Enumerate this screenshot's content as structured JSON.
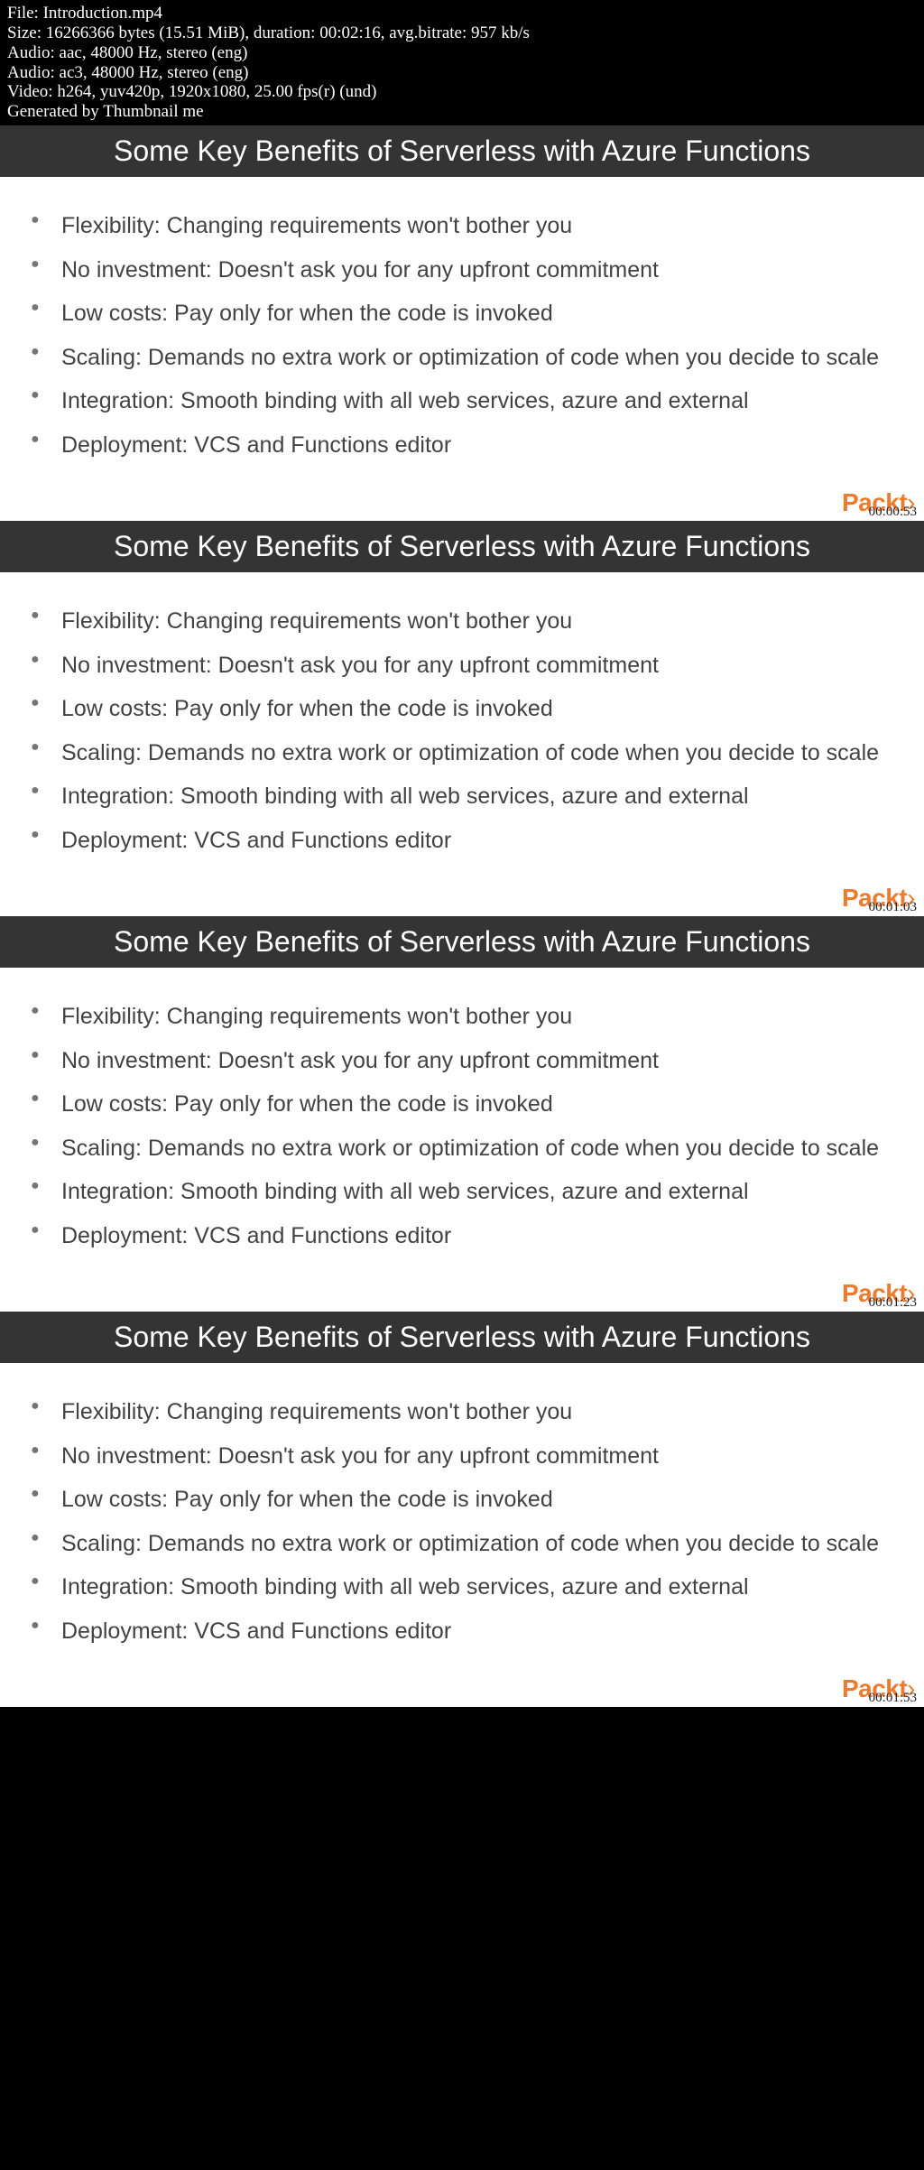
{
  "metadata": {
    "line1": "File: Introduction.mp4",
    "line2": "Size: 16266366 bytes (15.51 MiB), duration: 00:02:16, avg.bitrate: 957 kb/s",
    "line3": "Audio: aac, 48000 Hz, stereo (eng)",
    "line4": "Audio: ac3, 48000 Hz, stereo (eng)",
    "line5": "Video: h264, yuv420p, 1920x1080, 25.00 fps(r) (und)",
    "line6": "Generated by Thumbnail me"
  },
  "logo_text": "Packt",
  "logo_brackets": "›",
  "slides": [
    {
      "title": "Some Key Benefits of Serverless with Azure Functions",
      "timestamp": "00:00:53",
      "bullets": [
        "Flexibility: Changing requirements won't bother you",
        "No investment: Doesn't ask you for any upfront commitment",
        "Low costs: Pay only for when the code is invoked",
        "Scaling: Demands no extra work or optimization of code when you decide to scale",
        "Integration: Smooth binding with all web services, azure and external",
        "Deployment: VCS and Functions editor"
      ]
    },
    {
      "title": "Some Key Benefits of Serverless with Azure Functions",
      "timestamp": "00:01:03",
      "bullets": [
        "Flexibility: Changing requirements won't bother you",
        "No investment: Doesn't ask you for any upfront commitment",
        "Low costs: Pay only for when the code is invoked",
        "Scaling: Demands no extra work or optimization of code when you decide to scale",
        "Integration: Smooth binding with all web services, azure and external",
        "Deployment: VCS and Functions editor"
      ]
    },
    {
      "title": "Some Key Benefits of Serverless with Azure Functions",
      "timestamp": "00:01:23",
      "bullets": [
        "Flexibility: Changing requirements won't bother you",
        "No investment: Doesn't ask you for any upfront commitment",
        "Low costs: Pay only for when the code is invoked",
        "Scaling: Demands no extra work or optimization of code when you decide to scale",
        "Integration: Smooth binding with all web services, azure and external",
        "Deployment: VCS and Functions editor"
      ]
    },
    {
      "title": "Some Key Benefits of Serverless with Azure Functions",
      "timestamp": "00:01:53",
      "bullets": [
        "Flexibility: Changing requirements won't bother you",
        "No investment: Doesn't ask you for any upfront commitment",
        "Low costs: Pay only for when the code is invoked",
        "Scaling: Demands no extra work or optimization of code when you decide to scale",
        "Integration: Smooth binding with all web services, azure and external",
        "Deployment: VCS and Functions editor"
      ]
    }
  ]
}
